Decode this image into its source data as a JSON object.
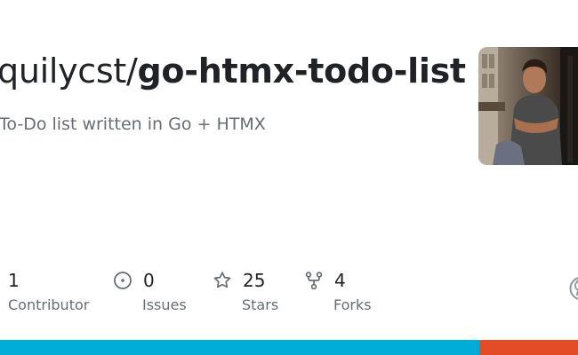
{
  "repo": {
    "owner": "quilycst/",
    "name": "go-htmx-todo-list",
    "description": "To-Do list written in Go + HTMX"
  },
  "stats": [
    {
      "value": "1",
      "label": "Contributor",
      "icon": "people-icon"
    },
    {
      "value": "0",
      "label": "Issues",
      "icon": "issue-icon"
    },
    {
      "value": "25",
      "label": "Stars",
      "icon": "star-icon"
    },
    {
      "value": "4",
      "label": "Forks",
      "icon": "fork-icon"
    }
  ],
  "languages": [
    {
      "share": 0.83,
      "color": "#00ADD8"
    },
    {
      "share": 0.17,
      "color": "#E34C26"
    }
  ]
}
